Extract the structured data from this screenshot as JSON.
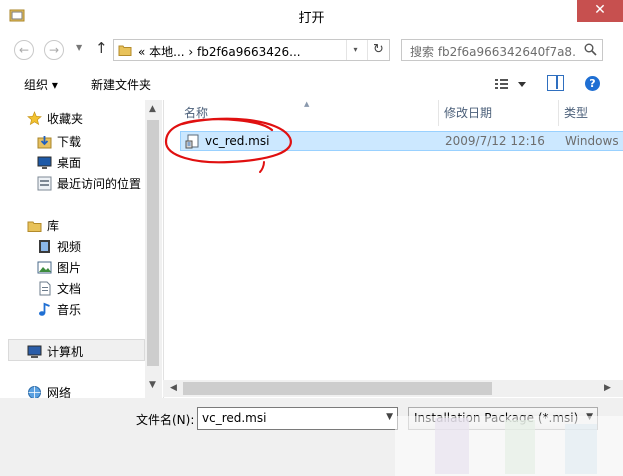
{
  "window": {
    "title": "打开",
    "close_symbol": "✕"
  },
  "nav": {
    "back_symbol": "←",
    "forward_symbol": "→",
    "up_symbol": "↑",
    "address_text": "« 本地... › fb2f6a9663426...",
    "address_sep": "›",
    "refresh_symbol": "↻",
    "search_placeholder": "搜索 fb2f6a966342640f7a8..."
  },
  "toolbar": {
    "organize_label": "组织 ▾",
    "new_folder_label": "新建文件夹",
    "help_label": "?"
  },
  "sidebar": {
    "items": [
      {
        "label": "收藏夹",
        "icon": "star-icon"
      },
      {
        "label": "下载",
        "icon": "downloads-icon"
      },
      {
        "label": "桌面",
        "icon": "desktop-icon"
      },
      {
        "label": "最近访问的位置",
        "icon": "recent-places-icon"
      },
      {
        "label": "库",
        "icon": "libraries-icon"
      },
      {
        "label": "视频",
        "icon": "videos-icon"
      },
      {
        "label": "图片",
        "icon": "pictures-icon"
      },
      {
        "label": "文档",
        "icon": "documents-icon"
      },
      {
        "label": "音乐",
        "icon": "music-icon"
      },
      {
        "label": "计算机",
        "icon": "computer-icon"
      },
      {
        "label": "网络",
        "icon": "network-icon"
      }
    ]
  },
  "files": {
    "columns": [
      "名称",
      "修改日期",
      "类型"
    ],
    "rows": [
      {
        "name": "vc_red.msi",
        "modified": "2009/7/12 12:16",
        "type": "Windows",
        "icon": "msi-installer-icon"
      }
    ]
  },
  "footer": {
    "filename_label": "文件名(N):",
    "filename_value": "vc_red.msi",
    "filetype_value": "Installation Package (*.msi)"
  },
  "colors": {
    "selection": "#cce8ff",
    "close_button": "#c7504f",
    "annotation": "#e01010"
  }
}
